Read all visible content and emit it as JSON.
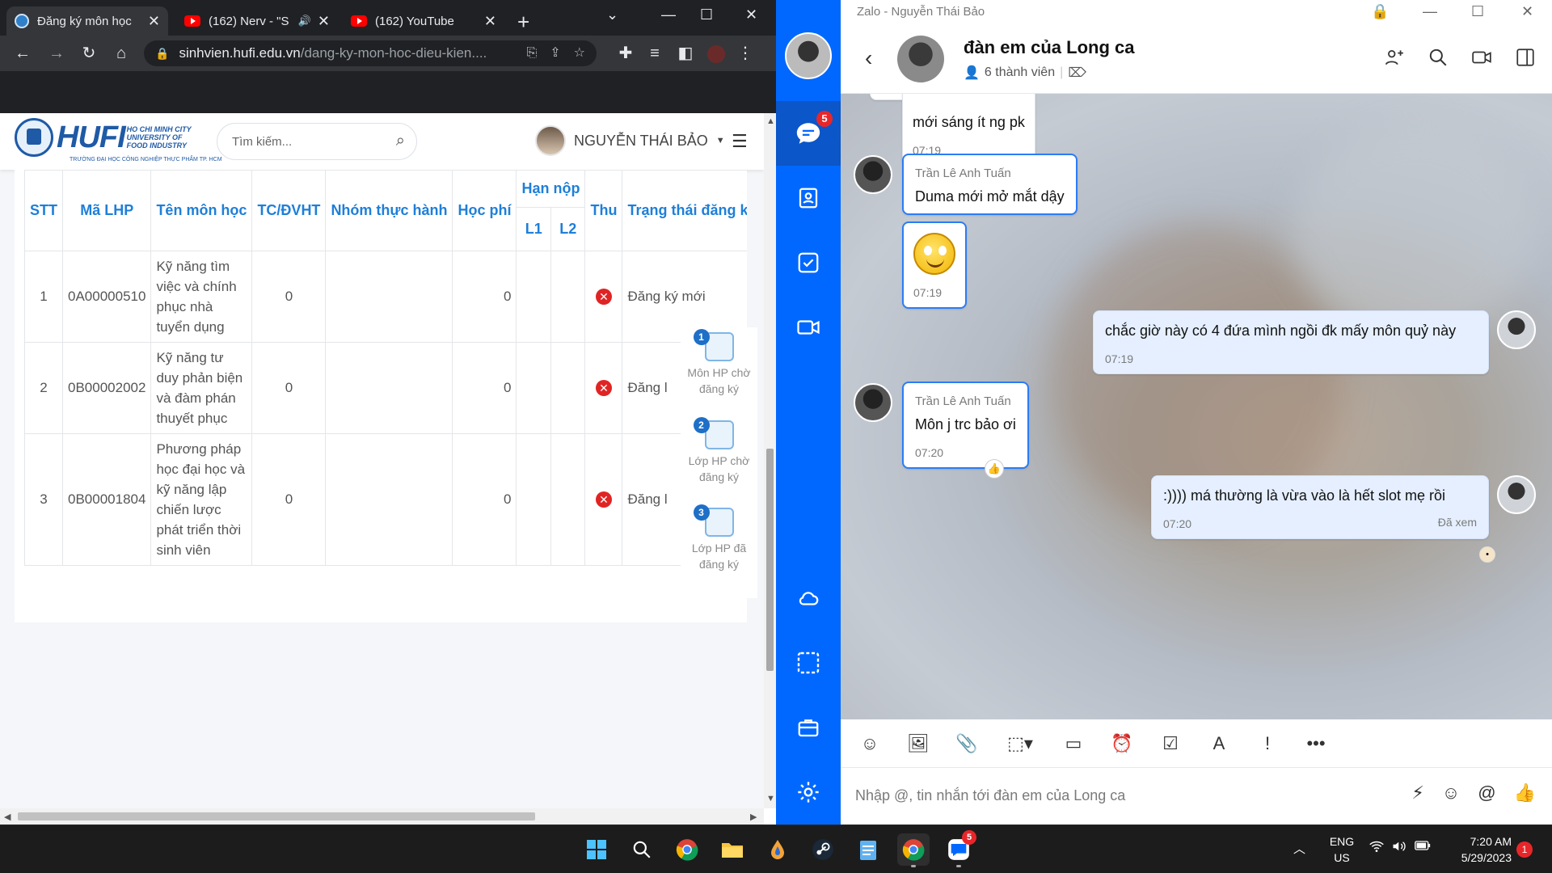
{
  "browser": {
    "tabs": [
      {
        "title": "Đăng ký môn học"
      },
      {
        "title": "(162) Nerv - \"S"
      },
      {
        "title": "(162) YouTube"
      }
    ],
    "url_host": "sinhvien.hufi.edu.vn",
    "url_path": "/dang-ky-mon-hoc-dieu-kien...."
  },
  "site": {
    "logo_text": "HUFI",
    "logo_sub": [
      "HO CHI MINH CITY",
      "UNIVERSITY OF",
      "FOOD INDUSTRY"
    ],
    "logo_line": "TRƯỜNG ĐẠI HỌC CÔNG NGHIỆP THỰC PHẨM TP. HCM",
    "search_placeholder": "Tìm kiếm...",
    "user_name": "NGUYỄN THÁI BẢO",
    "table": {
      "headers": {
        "stt": "STT",
        "ma_lhp": "Mã LHP",
        "ten_mon": "Tên môn học",
        "tc": "TC/ĐVHT",
        "nhom": "Nhóm thực hành",
        "hoc_phi": "Học phí",
        "han_nop": "Hạn nộp",
        "l1": "L1",
        "l2": "L2",
        "thu": "Thu",
        "trang_thai": "Trạng thái đăng k"
      },
      "rows": [
        {
          "stt": "1",
          "ma": "0A00000510",
          "ten": "Kỹ năng tìm việc và chính phục nhà tuyển dụng",
          "tc": "0",
          "nhom": "",
          "hoc_phi": "0",
          "trang_thai": "Đăng ký mới"
        },
        {
          "stt": "2",
          "ma": "0B00002002",
          "ten": "Kỹ năng tư duy phản biện và đàm phán thuyết phục",
          "tc": "0",
          "nhom": "",
          "hoc_phi": "0",
          "trang_thai": "Đăng l"
        },
        {
          "stt": "3",
          "ma": "0B00001804",
          "ten": "Phương pháp học đại học và kỹ năng lập chiến lược phát triển thời sinh viên",
          "tc": "0",
          "nhom": "",
          "hoc_phi": "0",
          "trang_thai": "Đăng l"
        }
      ]
    },
    "float_panel": [
      {
        "badge": "1",
        "label_1": "Môn HP chờ",
        "label_2": "đăng ký"
      },
      {
        "badge": "2",
        "label_1": "Lớp HP chờ",
        "label_2": "đăng ký"
      },
      {
        "badge": "3",
        "label_1": "Lớp HP đã",
        "label_2": "đăng ký"
      }
    ]
  },
  "zalo": {
    "window_title": "Zalo - Nguyễn Thái Bảo",
    "nav_badge": "5",
    "chat_title": "đàn em của Long ca",
    "members": "6 thành viên",
    "messages": [
      {
        "sender": "",
        "text": "mới sáng ít ng pk",
        "time": "07:19"
      },
      {
        "sender": "Trần Lê Anh Tuấn",
        "text": "Duma mới mở mắt dậy",
        "time": ""
      },
      {
        "sender": "",
        "text": "",
        "time": "07:19"
      },
      {
        "sender": "",
        "text": "chắc giờ này có 4 đứa mình ngồi đk mấy môn quỷ này",
        "time": "07:19"
      },
      {
        "sender": "Trần Lê Anh Tuấn",
        "text": "Môn j trc bảo ơi",
        "time": "07:20"
      },
      {
        "sender": "",
        "text": ":)))) má thường là vừa vào là hết slot mẹ rồi",
        "time": "07:20",
        "status": "Đã xem"
      }
    ],
    "input_placeholder": "Nhập @, tin nhắn tới đàn em của Long ca"
  },
  "taskbar": {
    "zalo_badge": "5",
    "lang_1": "ENG",
    "lang_2": "US",
    "time": "7:20 AM",
    "date": "5/29/2023",
    "notifications": "1"
  },
  "colors": {
    "zalo_blue": "#0068ff",
    "hufi_blue": "#1e7fd8",
    "error_red": "#e02424"
  }
}
